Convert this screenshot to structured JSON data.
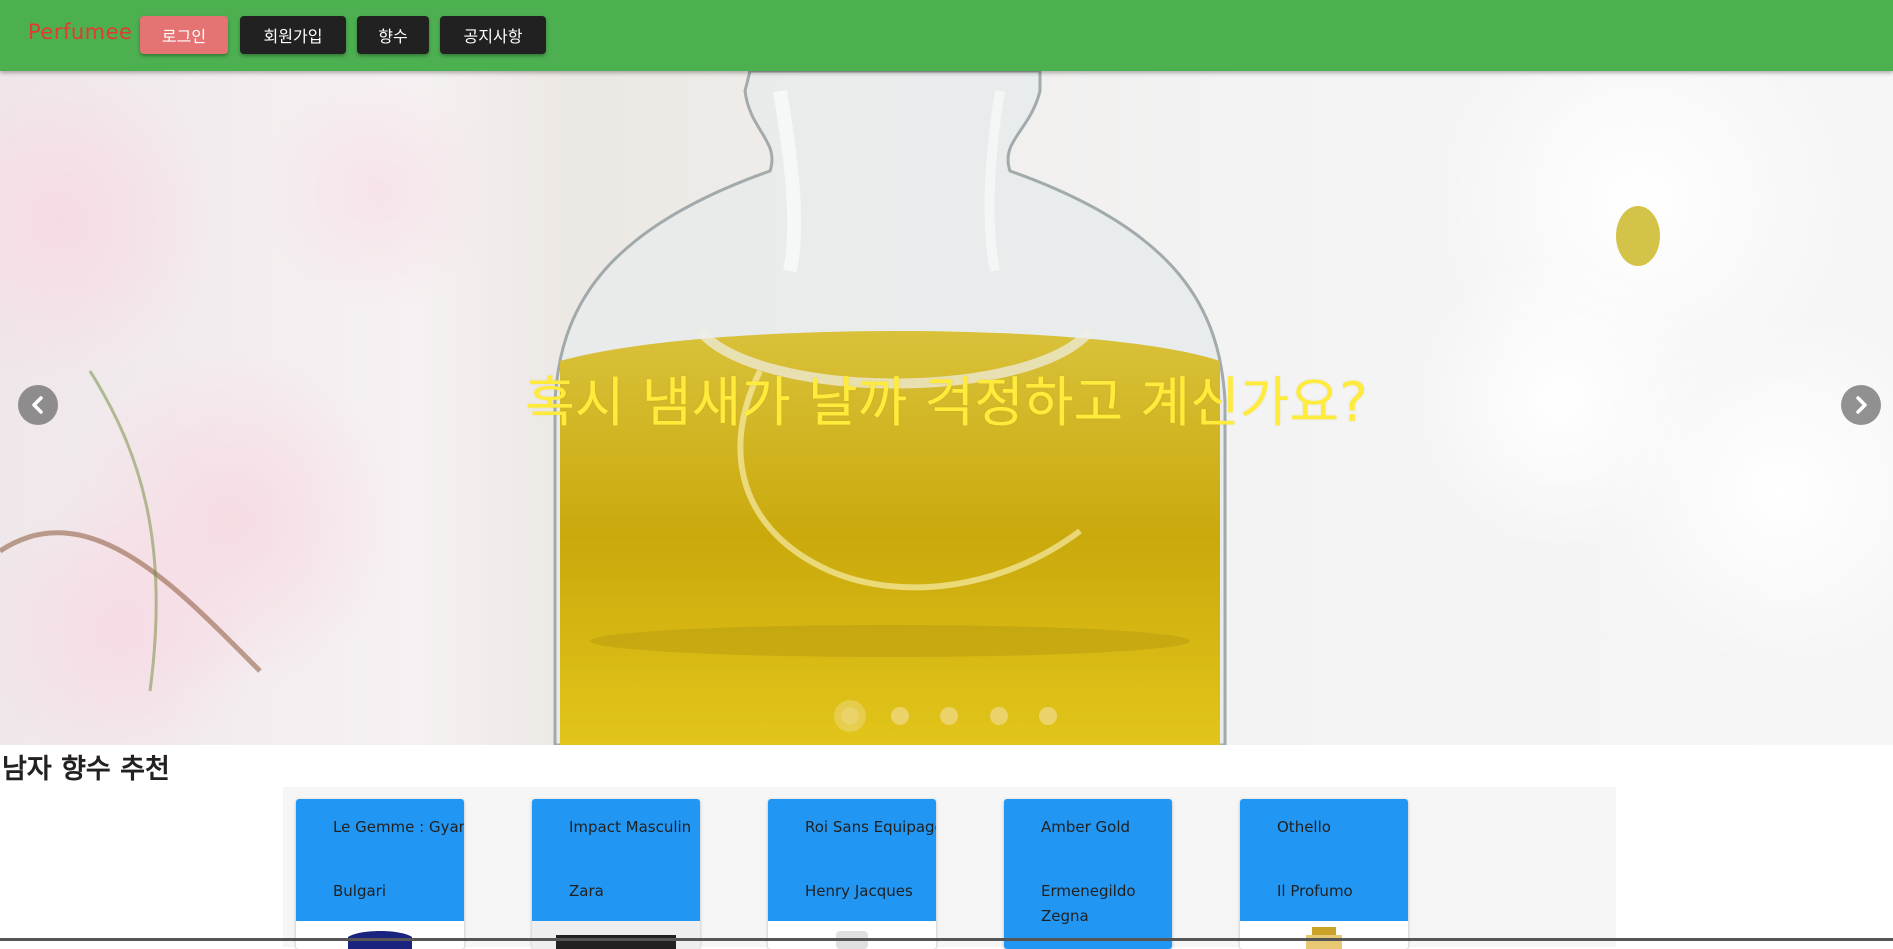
{
  "header": {
    "logo": "Perfumee",
    "nav": [
      {
        "label": "로그인"
      },
      {
        "label": "회원가입"
      },
      {
        "label": "향수"
      },
      {
        "label": "공지사항"
      }
    ]
  },
  "hero": {
    "caption": "혹시 냄새가 날까 걱정하고 계신가요?",
    "slide_count": 5,
    "active_slide": 1
  },
  "section": {
    "title": "남자 향수 추천"
  },
  "cards": [
    {
      "name": "Le Gemme : Gyan",
      "brand": "Bulgari"
    },
    {
      "name": "Impact Masculin",
      "brand": "Zara"
    },
    {
      "name": "Roi Sans Equipage",
      "brand": "Henry Jacques"
    },
    {
      "name": "Amber Gold",
      "brand": "Ermenegildo Zegna"
    },
    {
      "name": "Othello",
      "brand": "Il Profumo"
    }
  ],
  "colors": {
    "header_bg": "#4caf50",
    "logo": "#e53935",
    "login_button": "#e57373",
    "nav_button": "#212121",
    "caption": "#ffeb3b",
    "card_top": "#2196f3"
  },
  "icons": [
    "chevron-left-icon",
    "chevron-right-icon"
  ]
}
